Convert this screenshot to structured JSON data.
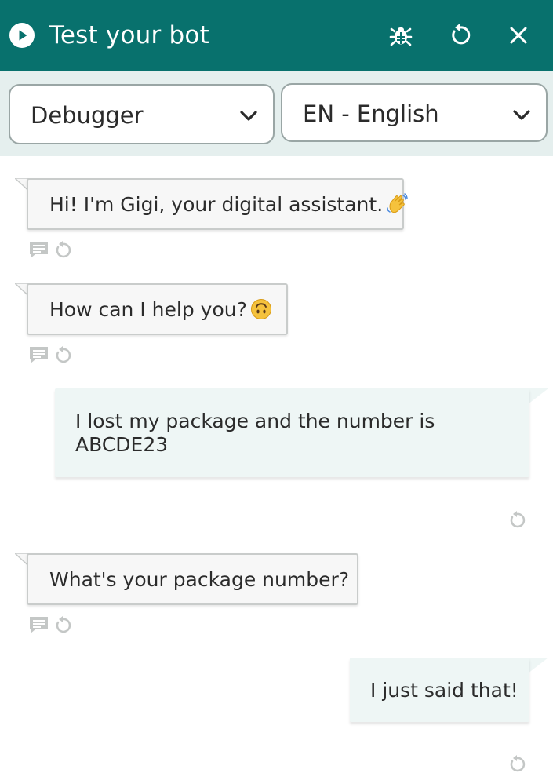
{
  "header": {
    "title": "Test your bot",
    "bg_color": "#08716d",
    "icons": [
      "play-circle-icon",
      "bug-icon",
      "reset-icon",
      "close-icon"
    ]
  },
  "toolbar": {
    "mode_select": {
      "value": "Debugger"
    },
    "language_select": {
      "value": "EN - English"
    }
  },
  "messages": [
    {
      "sender": "bot",
      "text": "Hi! I'm Gigi, your digital assistant.",
      "emoji": "waving-hand-icon"
    },
    {
      "sender": "bot",
      "text": "How can I help you?",
      "emoji": "upside-down-face-icon"
    },
    {
      "sender": "user",
      "line1": "I lost my package and the number is",
      "line2": "ABCDE23"
    },
    {
      "sender": "bot",
      "text": "What's your package number?"
    },
    {
      "sender": "user",
      "text": "I just said that!"
    }
  ]
}
